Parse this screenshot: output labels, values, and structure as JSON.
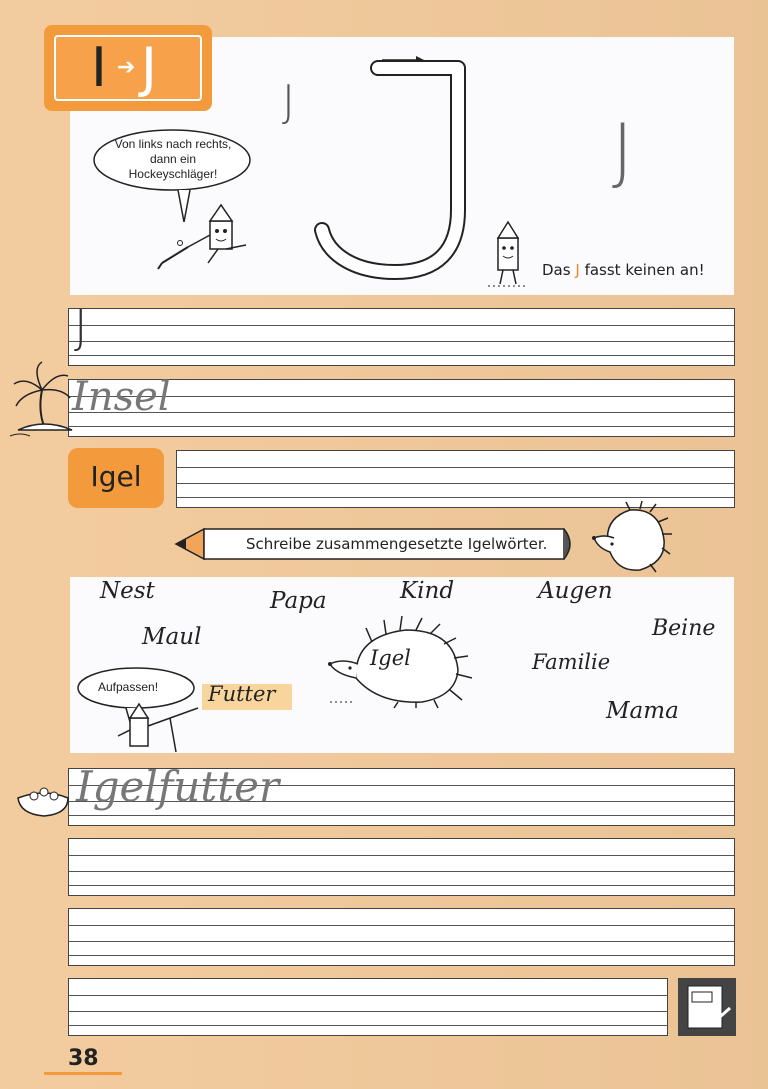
{
  "header": {
    "badge_from": "I",
    "badge_to": "J"
  },
  "intro": {
    "speech_bubble": "Von links nach rechts, dann ein Hockeyschläger!",
    "letter_small_left": "J",
    "letter_small_right": "J",
    "caption_prefix": "Das",
    "caption_letter": "J",
    "caption_suffix": "fasst keinen an!"
  },
  "practice": {
    "line1_sample": "J",
    "line2_sample": "Insel",
    "igel_box": "Igel"
  },
  "instruction": {
    "text": "Schreibe zusammengesetzte Igelwörter."
  },
  "words": {
    "items": [
      "Nest",
      "Papa",
      "Kind",
      "Augen",
      "Maul",
      "Beine",
      "Familie",
      "Mama",
      "Futter"
    ],
    "center": "Igel",
    "bubble": "Aufpassen!"
  },
  "writing": {
    "sample": "Igelfutter"
  },
  "footer": {
    "page_number": "38"
  },
  "colors": {
    "accent": "#f29a3c",
    "page_bg": "#f2c99a"
  }
}
